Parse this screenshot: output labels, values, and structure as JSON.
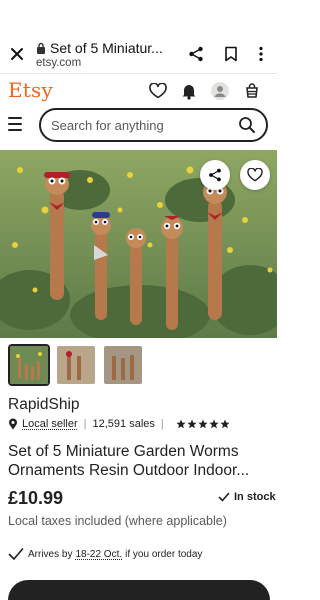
{
  "browser": {
    "page_title": "Set of 5 Miniatur...",
    "url": "etsy.com"
  },
  "header": {
    "logo_text": "Etsy",
    "brand_color": "#f1641e",
    "icons": [
      "heart-icon",
      "bell-icon",
      "avatar-icon",
      "cart-icon"
    ]
  },
  "search": {
    "placeholder": "Search for anything",
    "value": ""
  },
  "gallery": {
    "thumbnail_count": 3,
    "selected_index": 0
  },
  "shop": {
    "name": "RapidShip",
    "local_seller": "Local seller",
    "sales": "12,591 sales",
    "rating_stars": 5
  },
  "listing": {
    "title": "Set of 5 Miniature Garden Worms Ornaments Resin Outdoor Indoor...",
    "price": "£10.99",
    "stock": "In stock",
    "taxes_note": "Local taxes included (where applicable)"
  },
  "delivery": {
    "prefix": "Arrives by",
    "date": "18-22 Oct.",
    "suffix": "if you order today"
  }
}
